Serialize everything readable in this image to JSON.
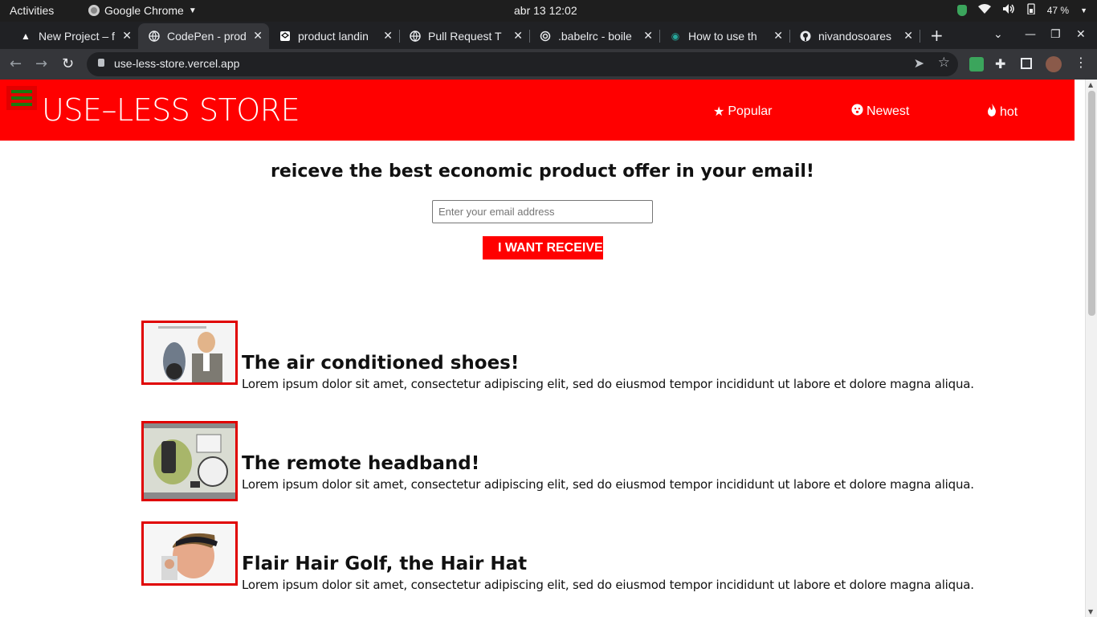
{
  "system_bar": {
    "activities": "Activities",
    "app_name": "Google Chrome",
    "clock": "abr 13  12:02",
    "battery": "47 %"
  },
  "tabs": [
    {
      "label": "New Project – f",
      "icon": "triangle-icon",
      "active": false
    },
    {
      "label": "CodePen - prod",
      "icon": "globe-icon",
      "active": true
    },
    {
      "label": "product landin",
      "icon": "codepen-icon",
      "active": false
    },
    {
      "label": "Pull Request T",
      "icon": "globe-icon",
      "active": false
    },
    {
      "label": ".babelrc - boile",
      "icon": "spiral-icon",
      "active": false
    },
    {
      "label": "How to use th",
      "icon": "eye-icon",
      "active": false
    },
    {
      "label": "nivandosoares",
      "icon": "github-icon",
      "active": false
    }
  ],
  "address_bar": {
    "url": "use-less-store.vercel.app"
  },
  "site": {
    "brand": "USE–LESS STORE",
    "nav": [
      {
        "label": "Popular",
        "icon": "star-icon"
      },
      {
        "label": "Newest",
        "icon": "face-icon"
      },
      {
        "label": "hot",
        "icon": "fire-icon"
      }
    ],
    "signup_title": "reiceve the best economic product offer in your email!",
    "email_placeholder": "Enter your email address",
    "submit_label": "I WANT RECEIVE"
  },
  "products": [
    {
      "title": "The air conditioned shoes!",
      "description": "Lorem ipsum dolor sit amet, consectetur adipiscing elit, sed do eiusmod tempor incididunt ut labore et dolore magna aliqua."
    },
    {
      "title": "The remote headband!",
      "description": "Lorem ipsum dolor sit amet, consectetur adipiscing elit, sed do eiusmod tempor incididunt ut labore et dolore magna aliqua."
    },
    {
      "title": "Flair Hair Golf, the Hair Hat",
      "description": "Lorem ipsum dolor sit amet, consectetur adipiscing elit, sed do eiusmod tempor incididunt ut labore et dolore magna aliqua."
    }
  ],
  "colors": {
    "brand_red": "#ff0000",
    "hamburger_green": "#1a7a10",
    "chrome_dark": "#202124"
  }
}
